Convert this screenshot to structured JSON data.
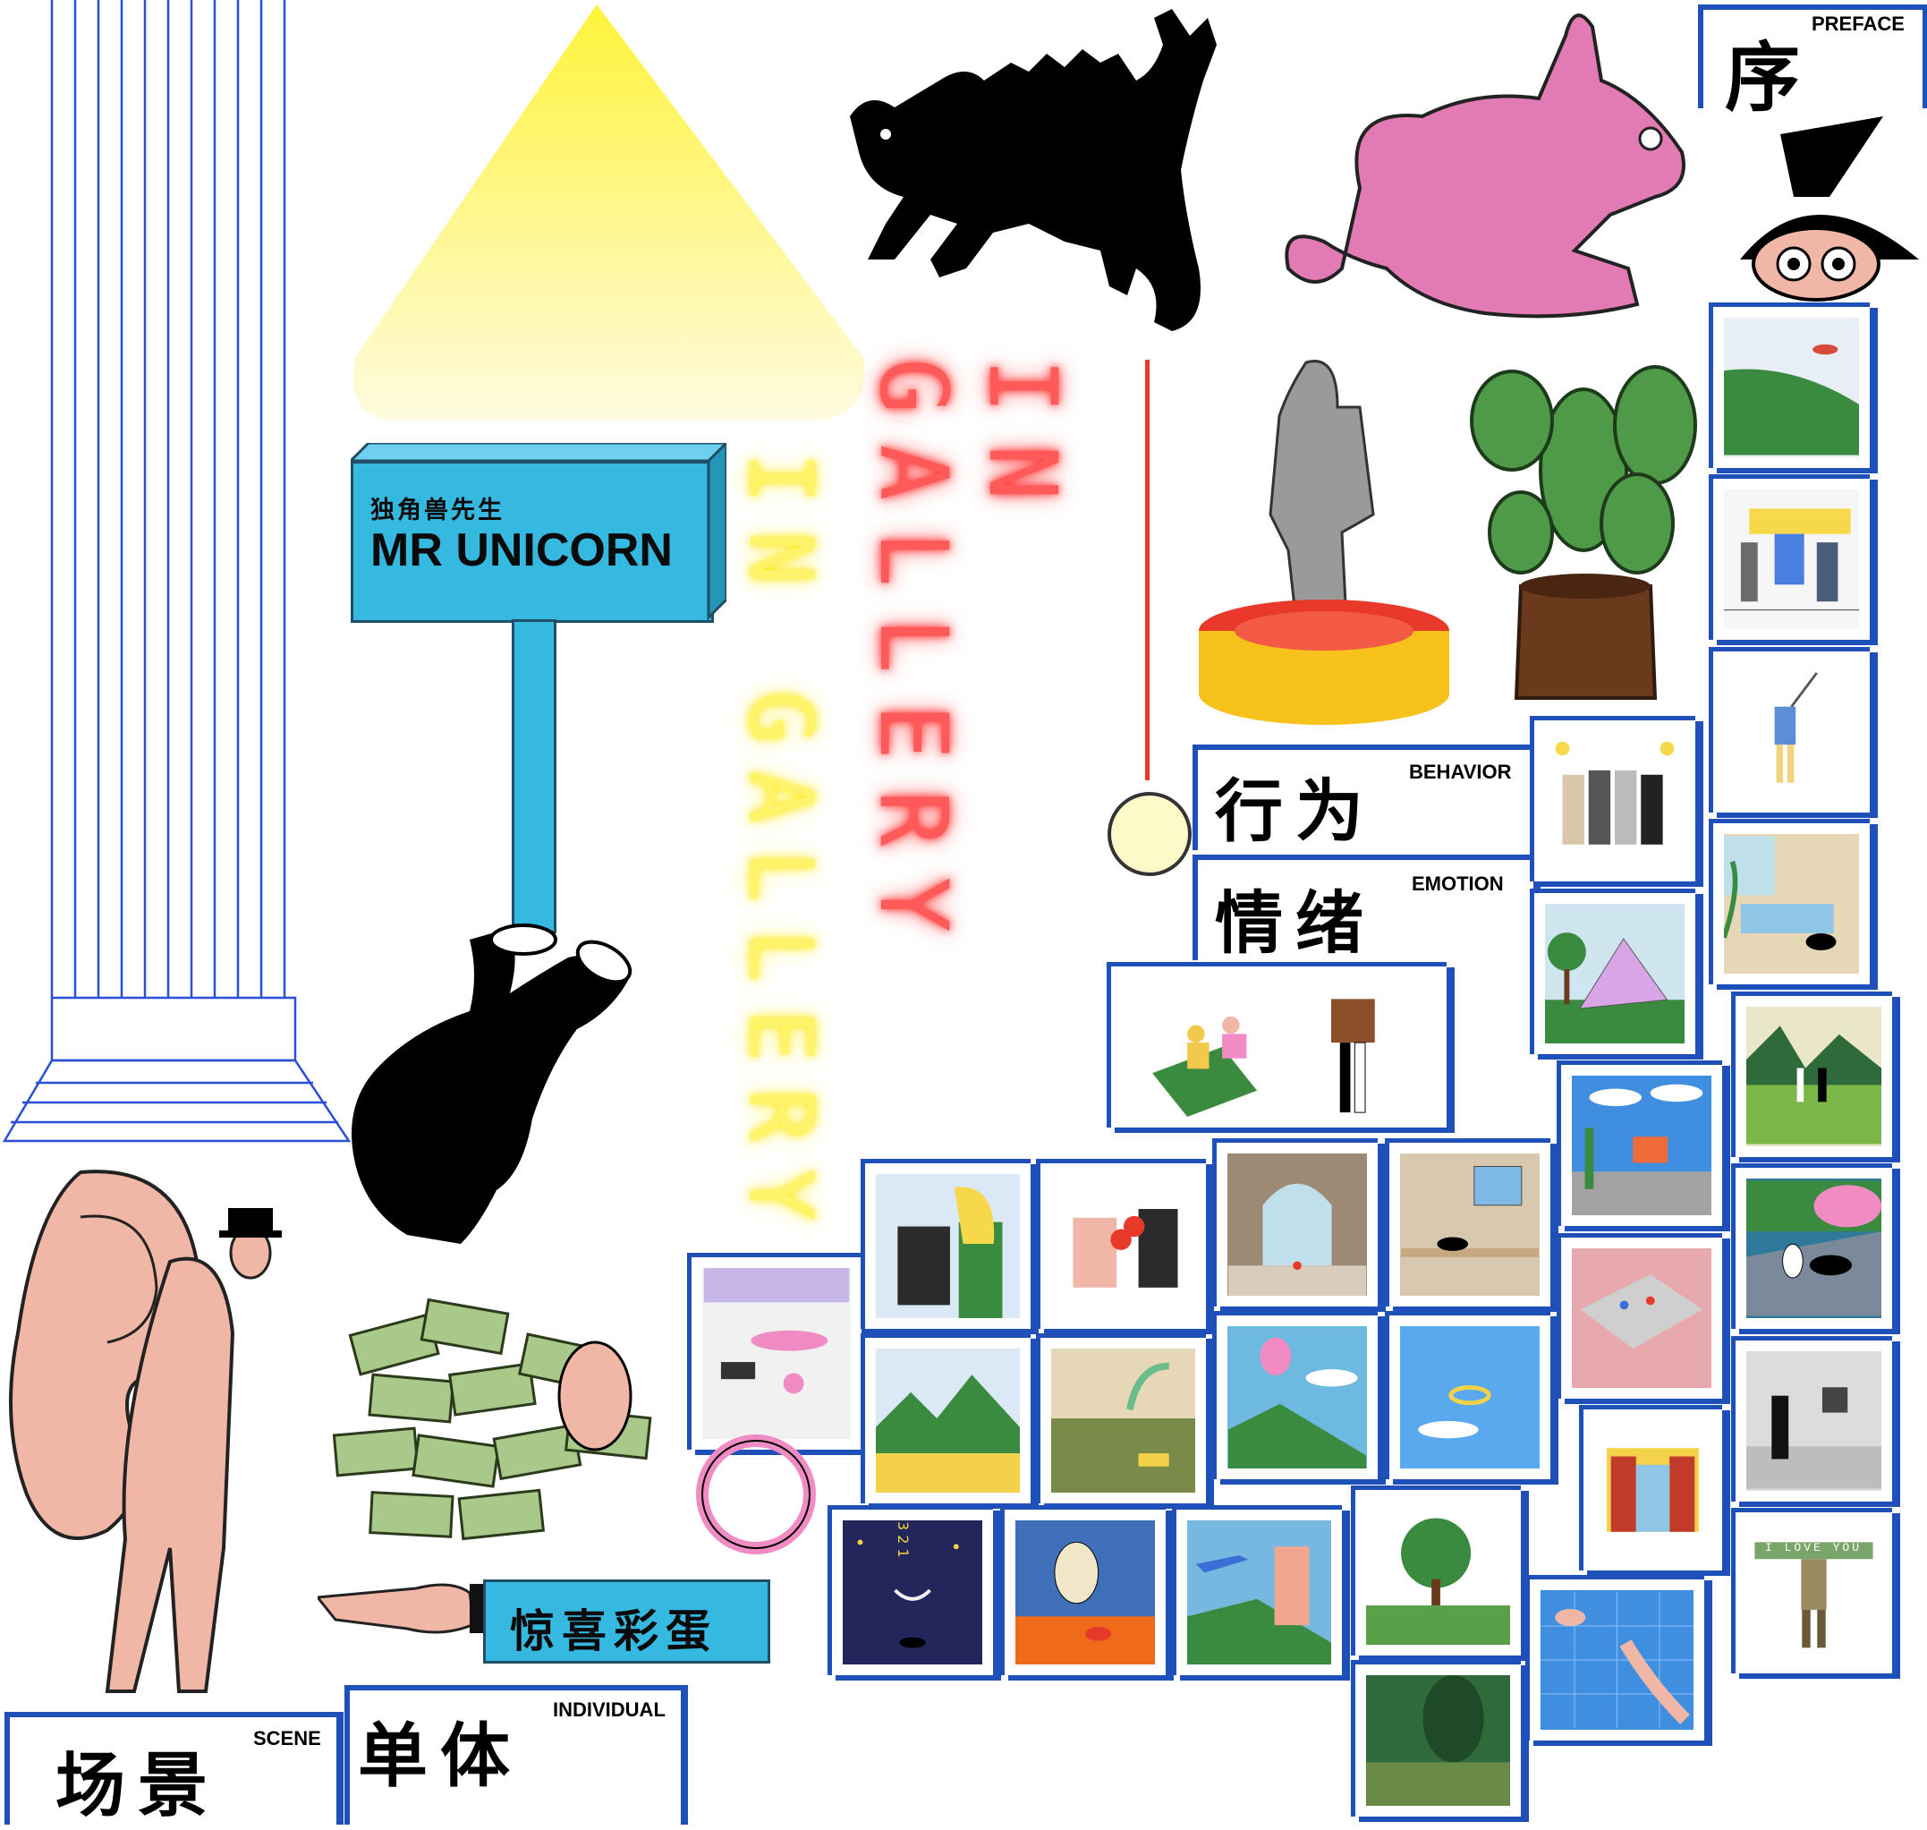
{
  "signpost": {
    "title_zh": "独角兽先生",
    "title_en": "MR UNICORN"
  },
  "neon": {
    "red_text": "IN GALLERY",
    "yellow_text": "IN GALLERY"
  },
  "sections": {
    "preface": {
      "zh": "序",
      "en": "PREFACE"
    },
    "behavior": {
      "zh": "行为",
      "en": "BEHAVIOR"
    },
    "emotion": {
      "zh": "情绪",
      "en": "EMOTION"
    },
    "scene": {
      "zh": "场景",
      "en": "SCENE"
    },
    "individual": {
      "zh": "单体",
      "en": "INDIVIDUAL"
    },
    "surprise": {
      "zh": "惊喜彩蛋"
    }
  },
  "artwork": {
    "love_banner": "I LOVE YOU",
    "countdown": "3 2 1"
  },
  "colors": {
    "frame_blue": "#1f4fb8",
    "sign_blue": "#35b9e0",
    "neon_red": "#ff5a5a",
    "neon_yellow": "#fff36a",
    "rabbit_pink": "#e27bb4",
    "skin": "#f2b8a8"
  }
}
